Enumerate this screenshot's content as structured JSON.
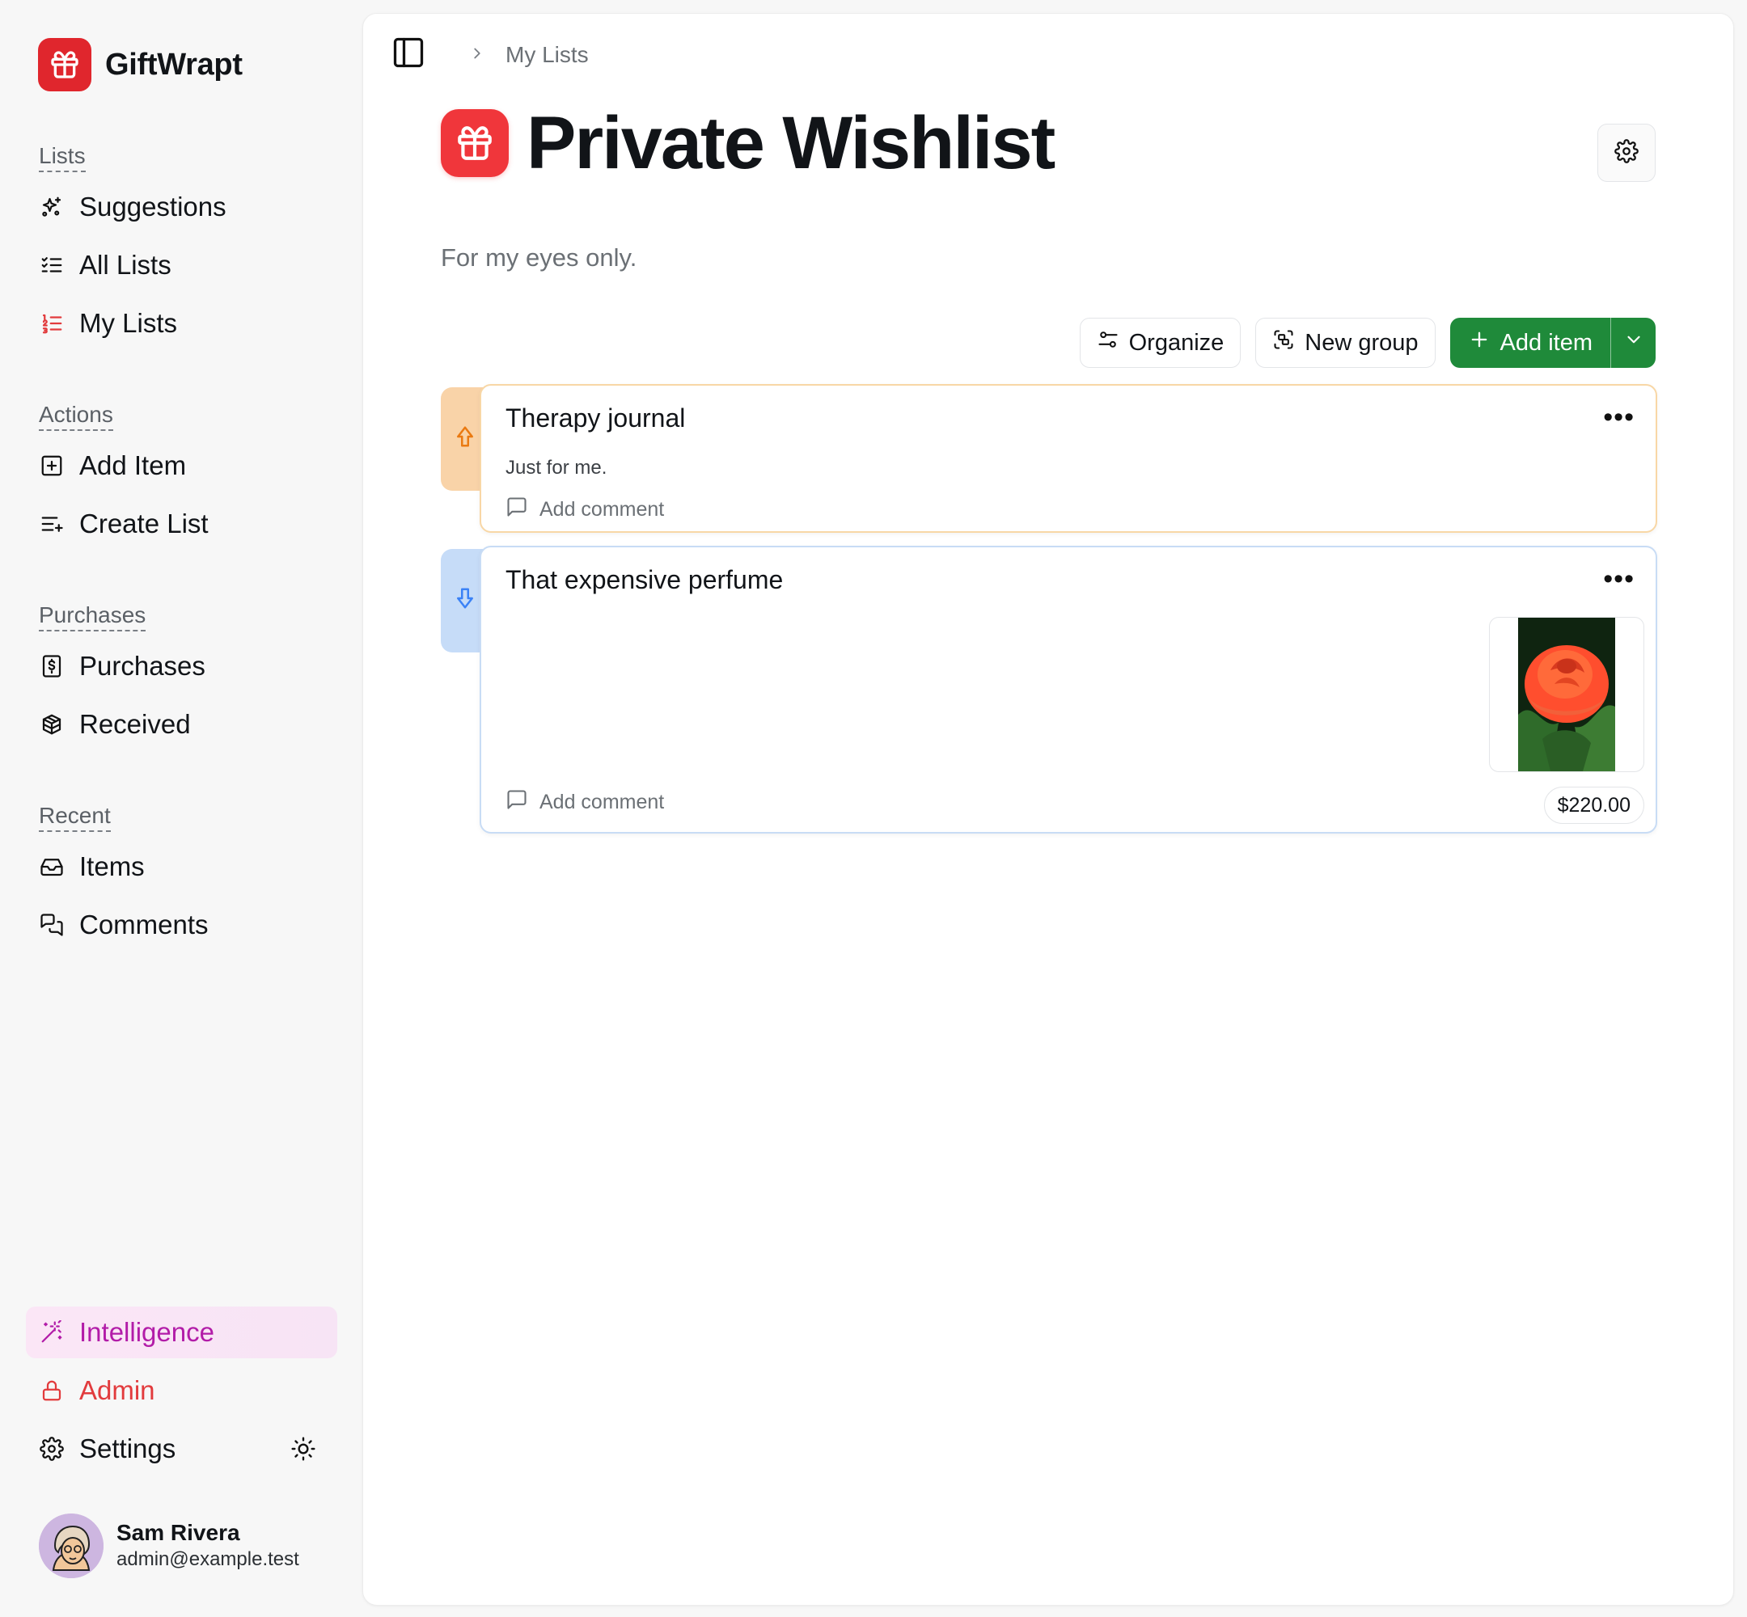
{
  "app": {
    "name": "GiftWrapt"
  },
  "sidebar": {
    "sections": [
      {
        "label": "Lists",
        "items": [
          {
            "label": "Suggestions",
            "icon": "sparkles-icon"
          },
          {
            "label": "All Lists",
            "icon": "list-check-icon"
          },
          {
            "label": "My Lists",
            "icon": "list-ordered-icon"
          }
        ]
      },
      {
        "label": "Actions",
        "items": [
          {
            "label": "Add Item",
            "icon": "square-plus-icon"
          },
          {
            "label": "Create List",
            "icon": "list-plus-icon"
          }
        ]
      },
      {
        "label": "Purchases",
        "items": [
          {
            "label": "Purchases",
            "icon": "receipt-dollar-icon"
          },
          {
            "label": "Received",
            "icon": "package-icon"
          }
        ]
      },
      {
        "label": "Recent",
        "items": [
          {
            "label": "Items",
            "icon": "inbox-icon"
          },
          {
            "label": "Comments",
            "icon": "messages-icon"
          }
        ]
      }
    ],
    "bottom": {
      "intelligence": "Intelligence",
      "admin": "Admin",
      "settings": "Settings"
    },
    "user": {
      "name": "Sam Rivera",
      "email": "admin@example.test"
    }
  },
  "breadcrumb": {
    "current": "My Lists"
  },
  "page": {
    "title": "Private Wishlist",
    "subtitle": "For my eyes only."
  },
  "toolbar": {
    "organize": "Organize",
    "new_group": "New group",
    "add_item": "Add item"
  },
  "items": [
    {
      "title": "Therapy journal",
      "description": "Just for me.",
      "comment": "Add comment",
      "priority": "high"
    },
    {
      "title": "That expensive perfume",
      "comment": "Add comment",
      "price": "$220.00",
      "priority": "low"
    }
  ],
  "colors": {
    "brand": "#e0262d",
    "green": "#1f8a3a",
    "high_priority": "#f59e0b",
    "low_priority": "#3b82f6",
    "intelligence": "#b21ca8",
    "admin": "#e23b3d"
  }
}
